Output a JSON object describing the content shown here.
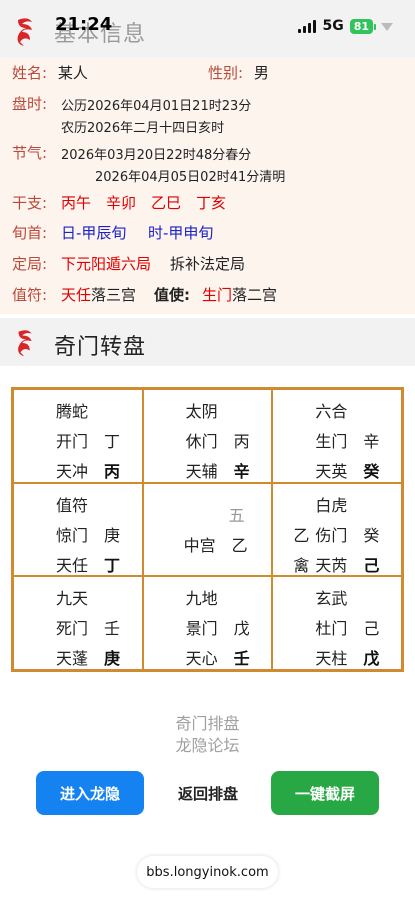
{
  "status_bar": {
    "time": "21:24",
    "network": "5G",
    "battery": "81"
  },
  "header1": {
    "title": "基本信息",
    "logo_icon": "dragon-logo-icon"
  },
  "info": {
    "name_label": "姓名:",
    "name_value": "某人",
    "gender_label": "性别:",
    "gender_value": "男",
    "time_label": "盘时:",
    "solar": "公历2026年04月01日21时23分",
    "lunar": "农历2026年二月十四日亥时",
    "jieqi_label": "节气:",
    "jieqi1": "2026年03月20日22时48分春分",
    "jieqi2": "2026年04月05日02时41分清明",
    "ganzhi_label": "干支:",
    "ganzhi": [
      "丙午",
      "辛卯",
      "乙巳",
      "丁亥"
    ],
    "xunshou_label": "旬首:",
    "xun1": "日-甲辰旬",
    "xun2": "时-甲申旬",
    "dingju_label": "定局:",
    "dingju_value": "下元阳遁六局",
    "dingju_method": "拆补法定局",
    "zhifu_label": "值符:",
    "zhifu_star": "天任",
    "zhifu_palace": "落三宫",
    "zhishi_label": "值使:",
    "zhishi_door": "生门",
    "zhishi_palace": "落二宫"
  },
  "header2": {
    "title": "奇门转盘",
    "logo_icon": "dragon-logo-icon"
  },
  "grid": {
    "cells": [
      {
        "god": "腾蛇",
        "door": "开门",
        "door_stem": "丁",
        "star": "天冲",
        "star_stem": "丙"
      },
      {
        "god": "太阴",
        "door": "休门",
        "door_stem": "丙",
        "star": "天辅",
        "star_stem": "辛"
      },
      {
        "god": "六合",
        "door": "生门",
        "door_stem": "辛",
        "star": "天英",
        "star_stem": "癸"
      },
      {
        "god": "值符",
        "door": "惊门",
        "door_stem": "庚",
        "star": "天任",
        "star_stem": "丁"
      },
      {
        "num": "五",
        "center": "中宫",
        "center_stem": "乙"
      },
      {
        "god": "白虎",
        "door_pre": "乙",
        "door": "伤门",
        "door_stem": "癸",
        "star_pre": "禽",
        "star": "天芮",
        "star_stem": "己"
      },
      {
        "god": "九天",
        "door": "死门",
        "door_stem": "壬",
        "star": "天蓬",
        "star_stem": "庚"
      },
      {
        "god": "九地",
        "door": "景门",
        "door_stem": "戊",
        "star": "天心",
        "star_stem": "壬"
      },
      {
        "god": "玄武",
        "door": "杜门",
        "door_stem": "己",
        "star": "天柱",
        "star_stem": "戊"
      }
    ]
  },
  "footer": {
    "line1": "奇门排盘",
    "line2": "龙隐论坛",
    "btn_enter": "进入龙隐",
    "btn_back": "返回排盘",
    "btn_screenshot": "一键截屏",
    "url": "bbs.longyinok.com"
  },
  "colors": {
    "accent_red": "#e00000",
    "accent_blue": "#1a22c8",
    "grid_border": "#d28a2e",
    "button_blue": "#1482f0",
    "button_green": "#28a745"
  }
}
